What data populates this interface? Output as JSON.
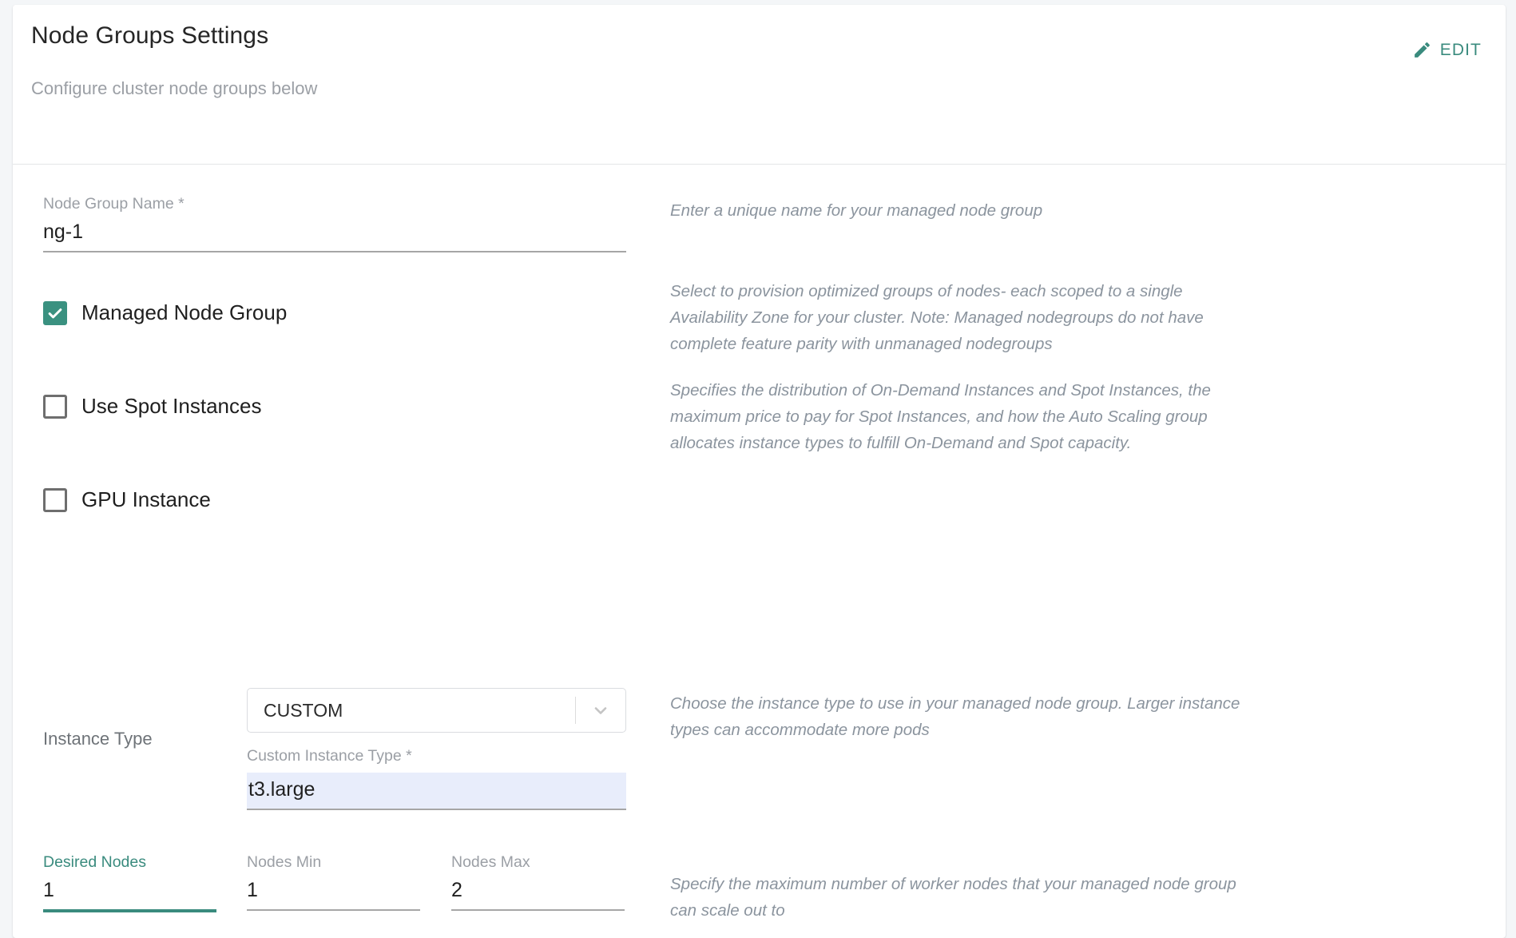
{
  "header": {
    "title": "Node Groups Settings",
    "subtitle": "Configure cluster node groups below",
    "edit_label": "EDIT",
    "edit_icon": "pencil-icon",
    "accent_color": "#3a8b7e"
  },
  "form": {
    "node_group_name": {
      "label": "Node Group Name *",
      "value": "ng-1",
      "help": "Enter a unique name for your managed node group"
    },
    "managed_node_group": {
      "label": "Managed Node Group",
      "checked": true,
      "help": "Select to provision optimized groups of nodes- each scoped to a single Availability Zone for your cluster. Note: Managed nodegroups do not have complete feature parity with unmanaged nodegroups"
    },
    "use_spot_instances": {
      "label": "Use Spot Instances",
      "checked": false,
      "help": "Specifies the distribution of On-Demand Instances and Spot Instances, the maximum price to pay for Spot Instances, and how the Auto Scaling group allocates instance types to fulfill On-Demand and Spot capacity."
    },
    "gpu_instance": {
      "label": "GPU Instance",
      "checked": false
    },
    "instance_type": {
      "label": "Instance Type",
      "selected": "CUSTOM",
      "help": "Choose the instance type to use in your managed node group. Larger instance types can accommodate more pods"
    },
    "custom_instance_type": {
      "label": "Custom Instance Type *",
      "value": "t3.large",
      "autofill_color": "#e8edfb"
    },
    "desired_nodes": {
      "label": "Desired Nodes",
      "value": "1",
      "focused": true
    },
    "nodes_min": {
      "label": "Nodes Min",
      "value": "1",
      "focused": false
    },
    "nodes_max": {
      "label": "Nodes Max",
      "value": "2",
      "focused": false,
      "help": "Specify the maximum number of worker nodes that your managed node group can scale out to"
    }
  }
}
